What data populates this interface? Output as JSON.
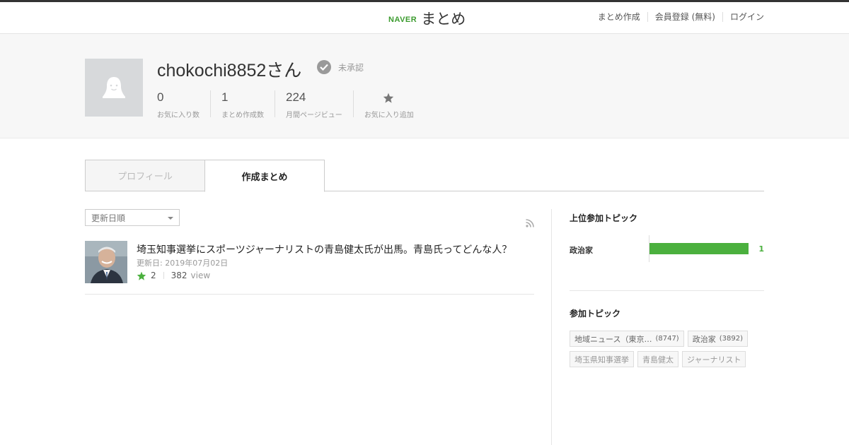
{
  "header": {
    "logo_naver": "NAVER",
    "logo_matome": "まとめ",
    "nav": [
      "まとめ作成",
      "会員登録 (無料)",
      "ログイン"
    ]
  },
  "profile": {
    "name": "chokochi8852さん",
    "status": "未承認",
    "stats": [
      {
        "value": "0",
        "label": "お気に入り数"
      },
      {
        "value": "1",
        "label": "まとめ作成数"
      },
      {
        "value": "224",
        "label": "月間ページビュー"
      }
    ],
    "add_favorite_label": "お気に入り追加"
  },
  "tabs": {
    "profile": "プロフィール",
    "created": "作成まとめ"
  },
  "list": {
    "sort_value": "更新日順",
    "items": [
      {
        "title": "埼玉知事選挙にスポーツジャーナリストの青島健太氏が出馬。青島氏ってどんな人？",
        "date": "更新日: 2019年07月02日",
        "favorites": "2",
        "views": "382",
        "views_unit": "view"
      }
    ]
  },
  "sidebar": {
    "top_topics_title": "上位参加トピック",
    "top_topics": [
      {
        "label": "政治家",
        "value": "1",
        "fraction": 1.0
      }
    ],
    "topics_title": "参加トピック",
    "tags": [
      {
        "label": "地域ニュース（東京…",
        "count": "(8747)"
      },
      {
        "label": "政治家",
        "count": "(3892)"
      },
      {
        "label": "埼玉県知事選挙",
        "count": ""
      },
      {
        "label": "青島健太",
        "count": ""
      },
      {
        "label": "ジャーナリスト",
        "count": ""
      }
    ]
  },
  "colors": {
    "accent_green": "#4bb03e",
    "naver_green": "#3b9b2e"
  }
}
